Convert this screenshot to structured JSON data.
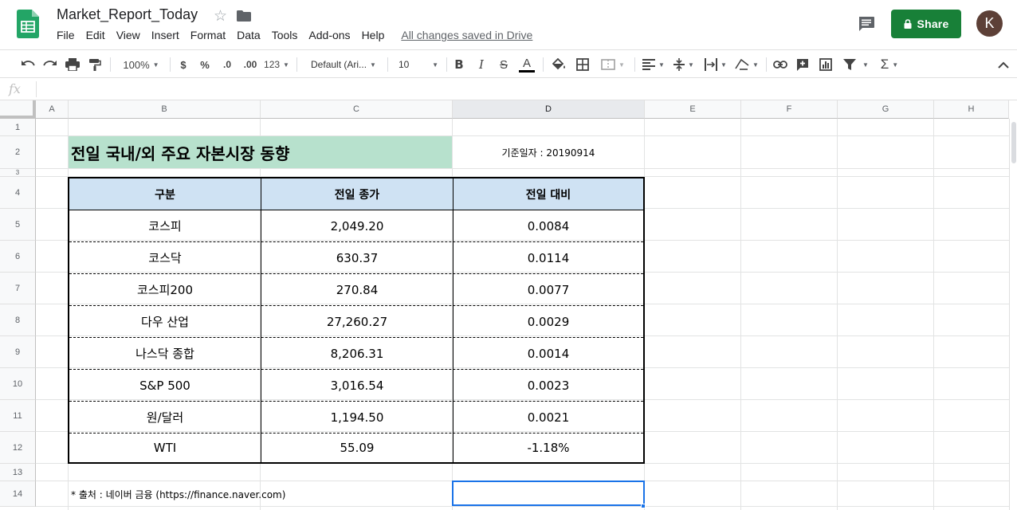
{
  "doc": {
    "title": "Market_Report_Today",
    "save_status": "All changes saved in Drive"
  },
  "menu": [
    "File",
    "Edit",
    "View",
    "Insert",
    "Format",
    "Data",
    "Tools",
    "Add-ons",
    "Help"
  ],
  "share": {
    "label": "Share"
  },
  "user": {
    "avatar_initial": "K",
    "avatar_color": "#5d4037"
  },
  "toolbar": {
    "zoom": "100%",
    "currency": "$",
    "percent": "%",
    "decrease_decimal": ".0",
    "increase_decimal": ".00",
    "more_formats": "123",
    "font": "Default (Ari...",
    "font_size": "10"
  },
  "formula_bar": {
    "fx": "fx",
    "value": ""
  },
  "columns": [
    "A",
    "B",
    "C",
    "D",
    "E",
    "F",
    "G",
    "H"
  ],
  "rows": [
    "1",
    "2",
    "3",
    "4",
    "5",
    "6",
    "7",
    "8",
    "9",
    "10",
    "11",
    "12",
    "13",
    "14"
  ],
  "sheet": {
    "title": "전일 국내/외 주요 자본시장 동향",
    "base_date": "기준일자 : 20190914",
    "headers": [
      "구분",
      "전일 종가",
      "전일 대비"
    ],
    "rows": [
      [
        "코스피",
        "2,049.20",
        "0.0084"
      ],
      [
        "코스닥",
        "630.37",
        "0.0114"
      ],
      [
        "코스피200",
        "270.84",
        "0.0077"
      ],
      [
        "다우 산업",
        "27,260.27",
        "0.0029"
      ],
      [
        "나스닥 종합",
        "8,206.31",
        "0.0014"
      ],
      [
        "S&P 500",
        "3,016.54",
        "0.0023"
      ],
      [
        "원/달러",
        "1,194.50",
        "0.0021"
      ],
      [
        "WTI",
        "55.09",
        "-1.18%"
      ]
    ],
    "source_note": "* 출처 : 네이버 금융 (https://finance.naver.com)"
  },
  "colors": {
    "share_green": "#188038",
    "title_fill": "#b7e1cd",
    "header_fill": "#cfe2f3",
    "selection_blue": "#1a73e8"
  }
}
